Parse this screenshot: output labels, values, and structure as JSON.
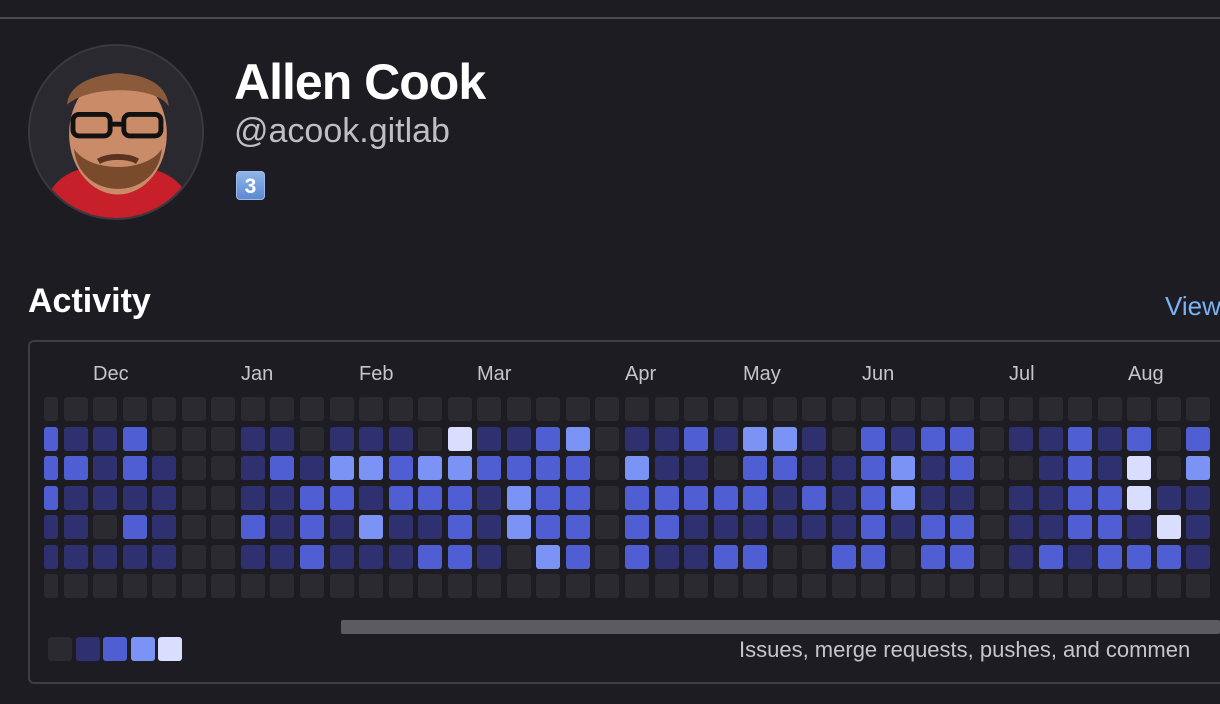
{
  "profile": {
    "name": "Allen Cook",
    "handle": "@acook.gitlab",
    "status_emoji": "3"
  },
  "activity": {
    "title": "Activity",
    "view_link": "View",
    "caption": "Issues, merge requests, pushes, and commen",
    "months": [
      "Dec",
      "Jan",
      "Feb",
      "Mar",
      "Apr",
      "May",
      "Jun",
      "Jul",
      "Aug"
    ],
    "level_colors": [
      "#2b2a31",
      "#2e3070",
      "#4f5fd3",
      "#7b93f5",
      "#d9deff"
    ],
    "levels_by_week": [
      [
        0,
        2,
        2,
        2,
        1,
        1,
        0
      ],
      [
        0,
        1,
        2,
        1,
        1,
        1,
        0
      ],
      [
        0,
        1,
        1,
        1,
        0,
        1,
        0
      ],
      [
        0,
        2,
        2,
        1,
        2,
        1,
        0
      ],
      [
        0,
        0,
        1,
        1,
        1,
        1,
        0
      ],
      [
        0,
        0,
        0,
        0,
        0,
        0,
        0
      ],
      [
        0,
        0,
        0,
        0,
        0,
        0,
        0
      ],
      [
        0,
        1,
        1,
        1,
        2,
        1,
        0
      ],
      [
        0,
        1,
        2,
        1,
        1,
        1,
        0
      ],
      [
        0,
        0,
        1,
        2,
        2,
        2,
        0
      ],
      [
        0,
        1,
        3,
        2,
        1,
        1,
        0
      ],
      [
        0,
        1,
        3,
        1,
        3,
        1,
        0
      ],
      [
        0,
        1,
        2,
        2,
        1,
        1,
        0
      ],
      [
        0,
        0,
        3,
        2,
        1,
        2,
        0
      ],
      [
        0,
        4,
        3,
        2,
        2,
        2,
        0
      ],
      [
        0,
        1,
        2,
        1,
        1,
        1,
        0
      ],
      [
        0,
        1,
        2,
        3,
        3,
        0,
        0
      ],
      [
        0,
        2,
        2,
        2,
        2,
        3,
        0
      ],
      [
        0,
        3,
        2,
        2,
        2,
        2,
        0
      ],
      [
        0,
        0,
        0,
        0,
        0,
        0,
        0
      ],
      [
        0,
        1,
        3,
        2,
        2,
        2,
        0
      ],
      [
        0,
        1,
        1,
        2,
        2,
        1,
        0
      ],
      [
        0,
        2,
        1,
        2,
        1,
        1,
        0
      ],
      [
        0,
        1,
        0,
        2,
        1,
        2,
        0
      ],
      [
        0,
        3,
        2,
        2,
        1,
        2,
        0
      ],
      [
        0,
        3,
        2,
        1,
        1,
        0,
        0
      ],
      [
        0,
        1,
        1,
        2,
        1,
        0,
        0
      ],
      [
        0,
        0,
        1,
        1,
        1,
        2,
        0
      ],
      [
        0,
        2,
        2,
        2,
        2,
        2,
        0
      ],
      [
        0,
        1,
        3,
        3,
        1,
        0,
        0
      ],
      [
        0,
        2,
        1,
        1,
        2,
        2,
        0
      ],
      [
        0,
        2,
        2,
        1,
        2,
        2,
        0
      ],
      [
        0,
        0,
        0,
        0,
        0,
        0,
        0
      ],
      [
        0,
        1,
        0,
        1,
        1,
        1,
        0
      ],
      [
        0,
        1,
        1,
        1,
        1,
        2,
        0
      ],
      [
        0,
        2,
        2,
        2,
        2,
        1,
        0
      ],
      [
        0,
        1,
        1,
        2,
        2,
        2,
        0
      ],
      [
        0,
        2,
        4,
        4,
        1,
        2,
        0
      ],
      [
        0,
        0,
        0,
        1,
        4,
        2,
        0
      ],
      [
        0,
        2,
        3,
        1,
        1,
        1,
        0
      ]
    ],
    "legend": [
      {
        "level": 0
      },
      {
        "level": 1
      },
      {
        "level": 2
      },
      {
        "level": 3
      },
      {
        "level": 4
      }
    ]
  }
}
